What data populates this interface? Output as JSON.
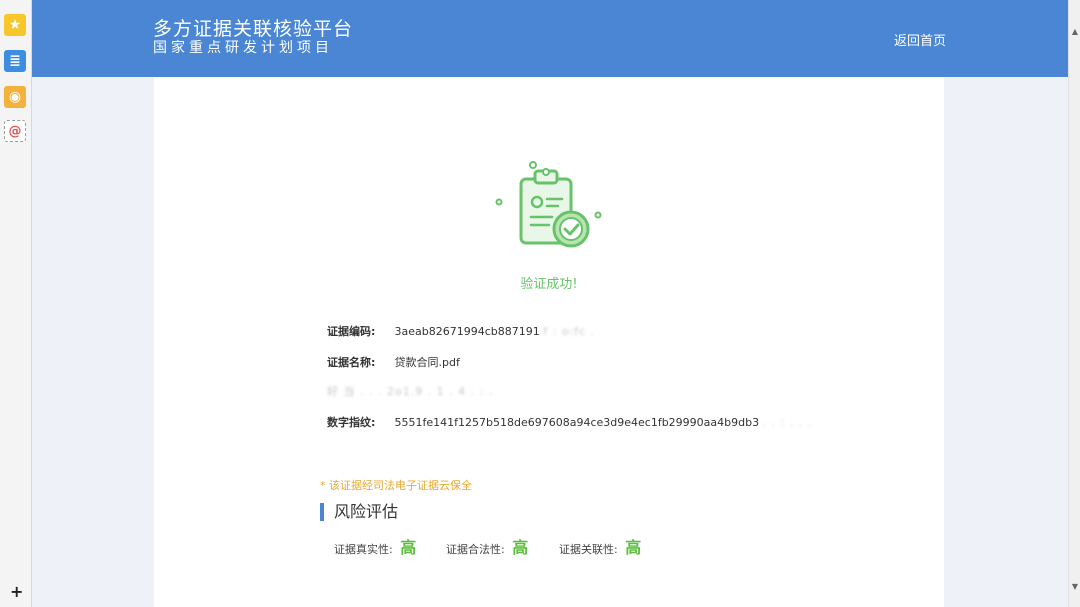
{
  "header": {
    "title": "多方证据关联核验平台",
    "subtitle": "国家重点研发计划项目",
    "home_link": "返回首页",
    "bg_color": "#4a86d4"
  },
  "sidebar": {
    "icons": [
      "star-icon",
      "note-icon",
      "weibo-icon",
      "mail-icon"
    ],
    "add": "+"
  },
  "result": {
    "message": "验证成功!",
    "accent_color": "#67c36a"
  },
  "evidence": {
    "code_label": "证据编码:",
    "code_value": "3aeab82671994cb887191",
    "code_blurred": "f : o:fc .",
    "name_label": "证据名称:",
    "name_value": "贷款合同.pdf",
    "blurred_row": "好 当 . . . 2o1.9 . 1 . 4 . : .",
    "fingerprint_label": "数字指纹:",
    "fingerprint_value": "5551fe141f1257b518de697608a94ce3d9e4ec1fb29990aa4b9db3",
    "fingerprint_blurred": ". . : . . ."
  },
  "note": "* 该证据经司法电子证据云保全",
  "risk": {
    "title": "风险评估",
    "items": [
      {
        "label": "证据真实性:",
        "level": "高"
      },
      {
        "label": "证据合法性:",
        "level": "高"
      },
      {
        "label": "证据关联性:",
        "level": "高"
      }
    ],
    "level_color": "#5bbf3c"
  }
}
